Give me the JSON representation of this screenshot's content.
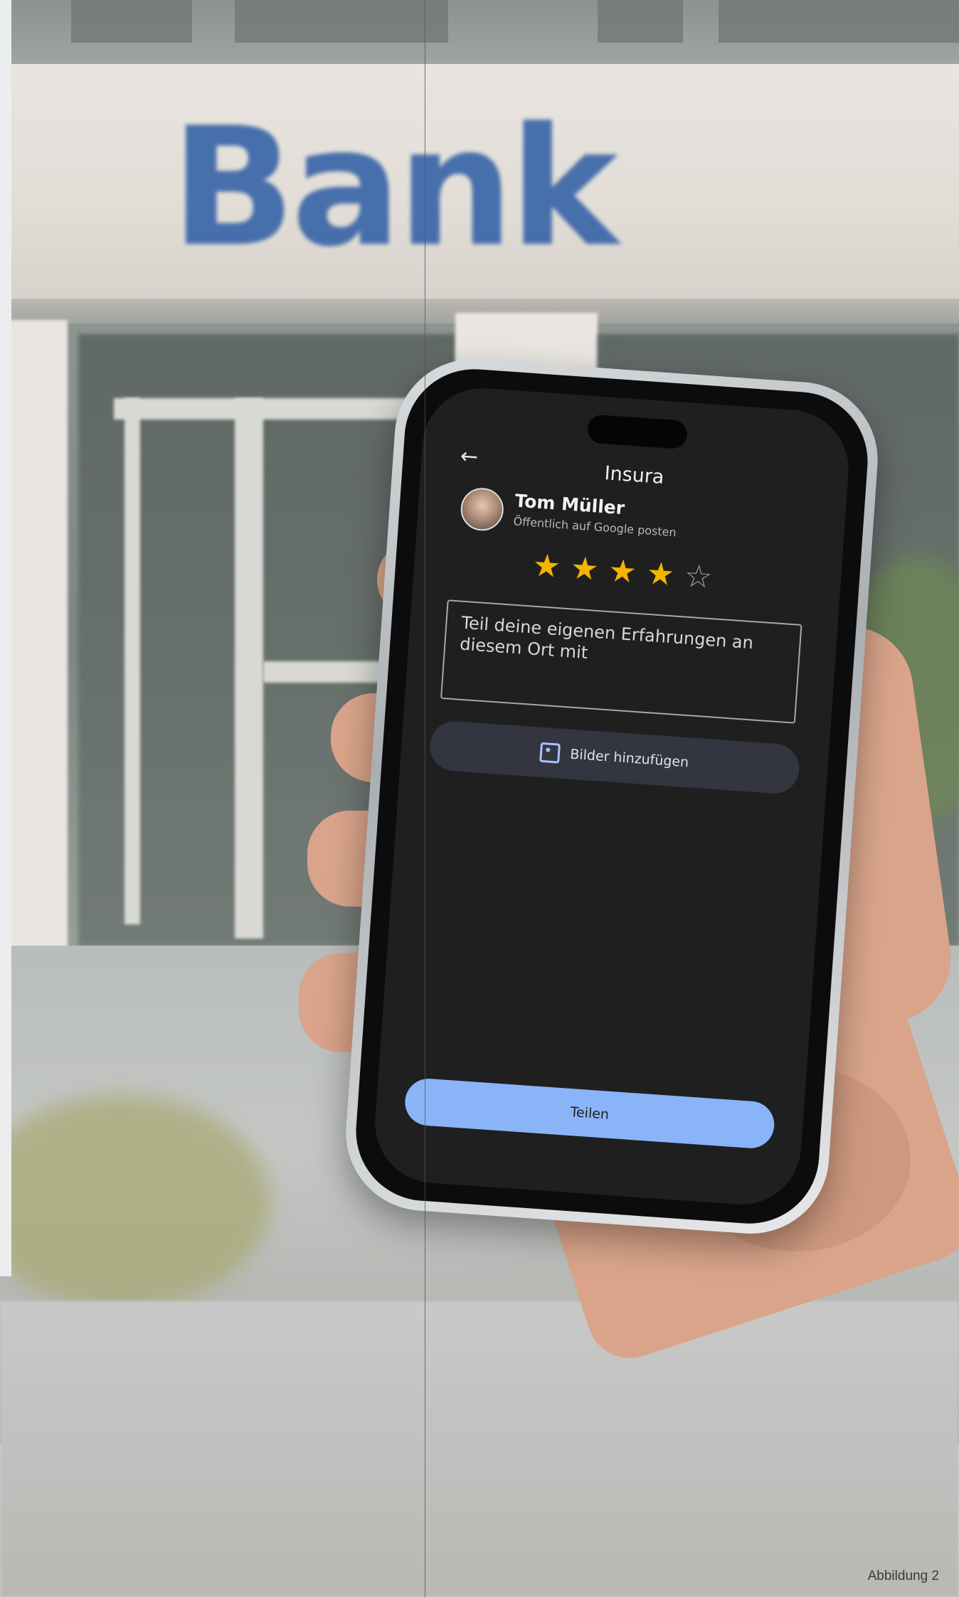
{
  "background": {
    "sign_text": "Bank",
    "caption": "Abbildung 2"
  },
  "app": {
    "title": "Insura",
    "back_icon": "arrow-left-icon",
    "user": {
      "name": "Tom Müller",
      "subtitle": "Öffentlich auf Google posten"
    },
    "rating": {
      "filled": 4,
      "total": 5
    },
    "review_placeholder": "Teil deine eigenen Erfahrungen an diesem Ort mit",
    "add_photos_label": "Bilder hinzufügen",
    "share_label": "Teilen"
  },
  "colors": {
    "star": "#f5b400",
    "share_button": "#8ab4f8",
    "bank_sign": "#3a66a8"
  }
}
